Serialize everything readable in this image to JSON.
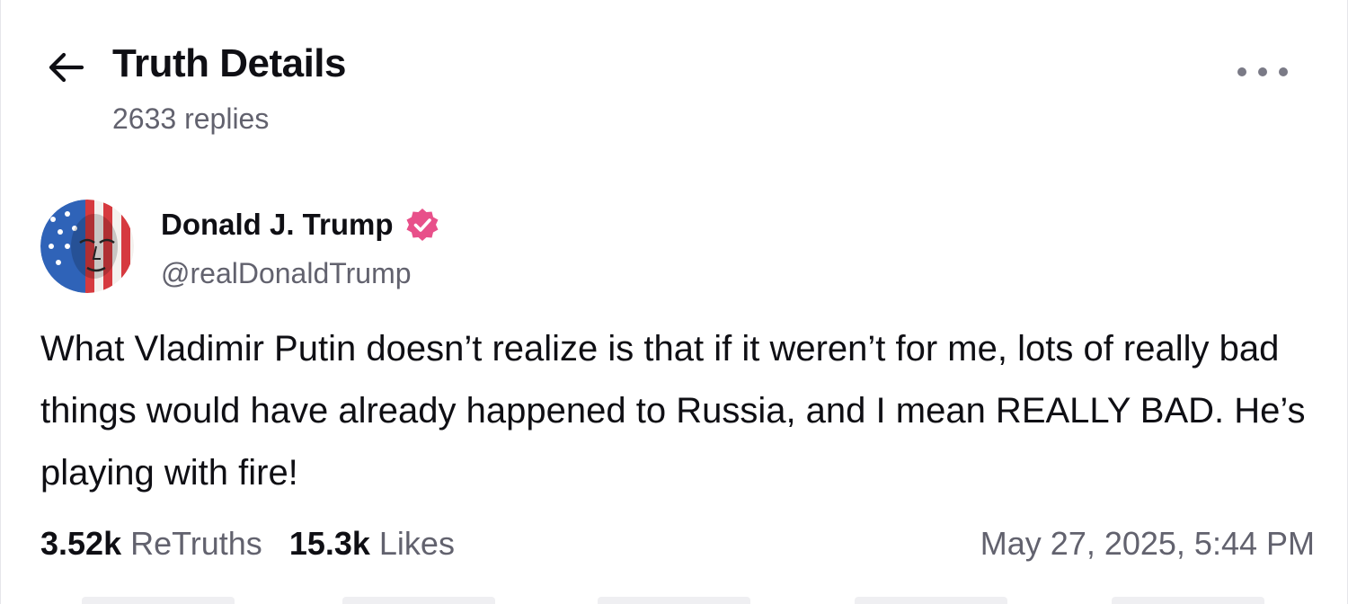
{
  "header": {
    "title": "Truth Details",
    "reply_count": "2633 replies",
    "back_icon": "arrow-left-icon",
    "more_icon": "more-horizontal-icon"
  },
  "post": {
    "author": {
      "display_name": "Donald J. Trump",
      "handle": "@realDonaldTrump",
      "verified": true,
      "verified_color": "#e8508a"
    },
    "text": "What Vladimir Putin doesn’t realize is that if it weren’t for me, lots of really bad things would have already happened to Russia, and I mean REALLY BAD. He’s playing with fire!",
    "stats": {
      "retruths_count": "3.52k",
      "retruths_label": "ReTruths",
      "likes_count": "15.3k",
      "likes_label": "Likes"
    },
    "timestamp": "May 27, 2025, 5:44 PM"
  },
  "colors": {
    "text_primary": "#0f0f14",
    "text_secondary": "#62626e",
    "accent": "#e8508a"
  }
}
